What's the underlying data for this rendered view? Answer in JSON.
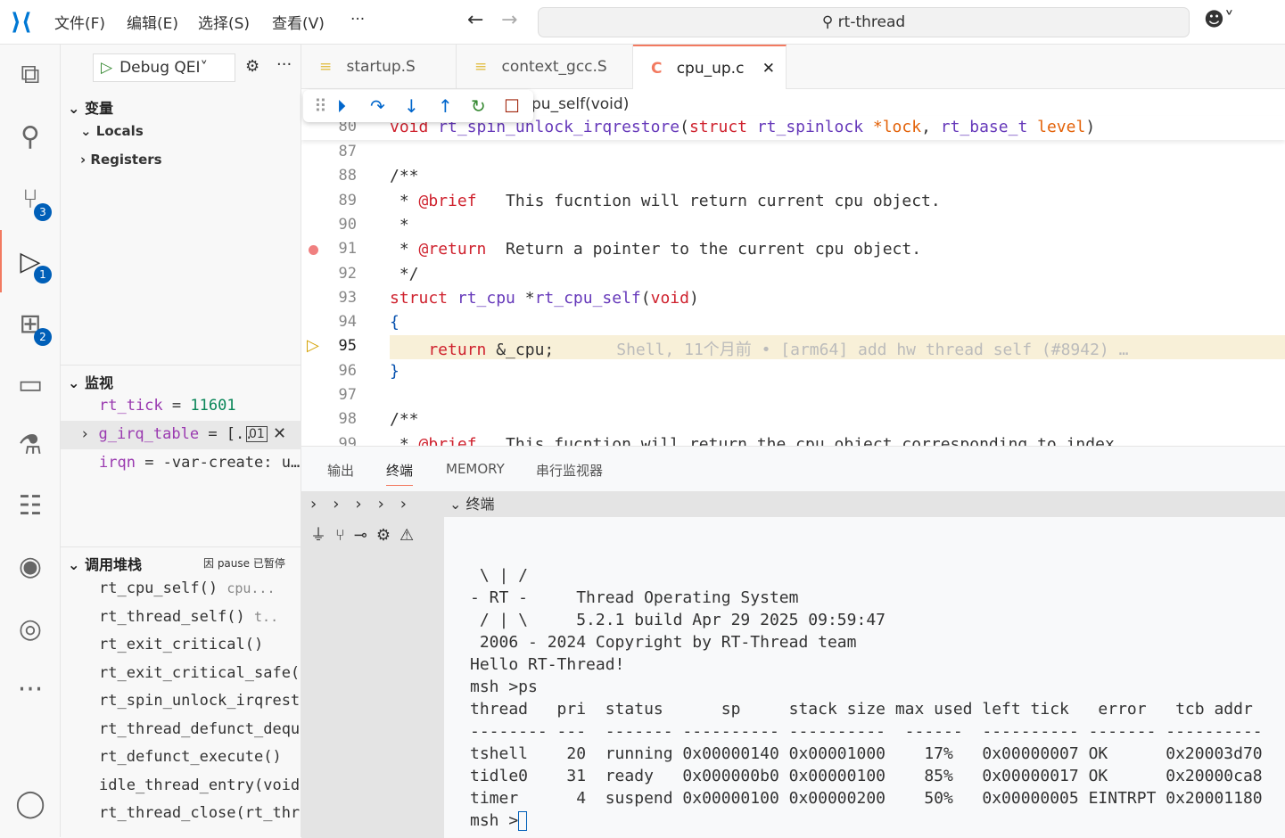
{
  "titlebar": {
    "menus": [
      "文件(F)",
      "编辑(E)",
      "选择(S)",
      "查看(V)",
      "···"
    ],
    "search": "rt-thread"
  },
  "activity": {
    "badges": {
      "scm": "3",
      "debug": "1",
      "extensions": "2"
    }
  },
  "sidebar": {
    "run_config": "Debug QEI",
    "variables_title": "变量",
    "locals": "Locals",
    "registers": "Registers",
    "watch_title": "监视",
    "watch": [
      {
        "name": "rt_tick",
        "eq": " = ",
        "value": "11601"
      },
      {
        "name": "g_irq_table",
        "eq": " = ",
        "value": "[.."
      },
      {
        "name": "irqn",
        "eq": " = ",
        "value": "-var-create: u…"
      }
    ],
    "callstack_title": "调用堆栈",
    "callstack_status": "因 pause 已暂停",
    "callstack": [
      {
        "fn": "rt_cpu_self()",
        "file": "cpu..."
      },
      {
        "fn": "rt_thread_self()",
        "file": "t.."
      },
      {
        "fn": "rt_exit_critical()",
        "file": ""
      },
      {
        "fn": "rt_exit_critical_safe(",
        "file": ""
      },
      {
        "fn": "rt_spin_unlock_irqrest",
        "file": ""
      },
      {
        "fn": "rt_thread_defunct_dequ",
        "file": ""
      },
      {
        "fn": "rt_defunct_execute()",
        "file": ""
      },
      {
        "fn": "idle_thread_entry(void",
        "file": ""
      },
      {
        "fn": "rt_thread_close(rt_thr",
        "file": ""
      }
    ]
  },
  "tabs": [
    {
      "label": "startup.S",
      "icon": "≡"
    },
    {
      "label": "context_gcc.S",
      "icon": "≡"
    },
    {
      "label": "cpu_up.c",
      "icon": "C"
    }
  ],
  "editor": {
    "breadcrumb": "pu_self(void)",
    "sticky": {
      "ln": "80",
      "tokens": [
        [
          "void ",
          "kw"
        ],
        [
          "rt_spin_unlock_irqrestore",
          "fn"
        ],
        [
          "(",
          ""
        ],
        [
          "struct ",
          "kw"
        ],
        [
          "rt_spinlock ",
          "fn"
        ],
        [
          "*lock",
          "pm"
        ],
        [
          ", ",
          ""
        ],
        [
          "rt_base_t ",
          "fn"
        ],
        [
          "level",
          "pm"
        ],
        [
          ")",
          ""
        ]
      ]
    },
    "lines": [
      {
        "ln": "87",
        "tokens": []
      },
      {
        "ln": "88",
        "tokens": [
          [
            "/**",
            ""
          ]
        ]
      },
      {
        "ln": "89",
        "tokens": [
          [
            " * ",
            ""
          ],
          [
            "@brief",
            "tag"
          ],
          [
            "   This fucntion will return current cpu object.",
            ""
          ]
        ]
      },
      {
        "ln": "90",
        "tokens": [
          [
            " *",
            ""
          ]
        ]
      },
      {
        "ln": "91",
        "tokens": [
          [
            " * ",
            ""
          ],
          [
            "@return",
            "tag"
          ],
          [
            "  Return a pointer to the current cpu object.",
            ""
          ]
        ]
      },
      {
        "ln": "92",
        "tokens": [
          [
            " */",
            ""
          ]
        ]
      },
      {
        "ln": "93",
        "tokens": [
          [
            "struct ",
            "kw"
          ],
          [
            "rt_cpu ",
            "fn"
          ],
          [
            "*",
            ""
          ],
          [
            "rt_cpu_self",
            "fn"
          ],
          [
            "(",
            ""
          ],
          [
            "void",
            "kw"
          ],
          [
            ")",
            ""
          ]
        ]
      },
      {
        "ln": "94",
        "tokens": [
          [
            "{",
            "br"
          ]
        ]
      },
      {
        "ln": "95",
        "tokens": [
          [
            "    return ",
            "kw"
          ],
          [
            "&_cpu;",
            ""
          ]
        ]
      },
      {
        "ln": "96",
        "tokens": [
          [
            "}",
            "br"
          ]
        ]
      },
      {
        "ln": "97",
        "tokens": []
      },
      {
        "ln": "98",
        "tokens": [
          [
            "/**",
            ""
          ]
        ]
      },
      {
        "ln": "99",
        "tokens": [
          [
            " * ",
            ""
          ],
          [
            "@brief",
            "tag"
          ],
          [
            "   This fucntion will return the cpu object corresponding to index.",
            ""
          ]
        ]
      }
    ],
    "blame": "Shell, 11个月前 • [arm64] add hw thread self (#8942) …",
    "current_line": "95",
    "breakpoint_line": "91"
  },
  "panel": {
    "tabs": [
      "输出",
      "终端",
      "MEMORY",
      "串行监视器"
    ],
    "active_tab": "终端",
    "terminal_header": "终端"
  },
  "terminal": {
    "lines": [
      " \\ | /",
      "- RT -     Thread Operating System",
      " / | \\     5.2.1 build Apr 29 2025 09:59:47",
      " 2006 - 2024 Copyright by RT-Thread team",
      "Hello RT-Thread!",
      "msh >ps",
      "thread   pri  status      sp     stack size max used left tick   error   tcb addr",
      "-------- ---  ------- ---------- ----------  ------  ---------- ------- ----------",
      "tshell    20  running 0x00000140 0x00001000    17%   0x00000007 OK      0x20003d70",
      "tidle0    31  ready   0x000000b0 0x00000100    85%   0x00000017 OK      0x20000ca8",
      "timer      4  suspend 0x00000100 0x00000200    50%   0x00000005 EINTRPT 0x20001180"
    ],
    "prompt": "msh >"
  },
  "colors": {
    "accent": "#005fb8",
    "tab_active_border": "#f27a60",
    "current_line_bg": "#f8f0d8"
  }
}
